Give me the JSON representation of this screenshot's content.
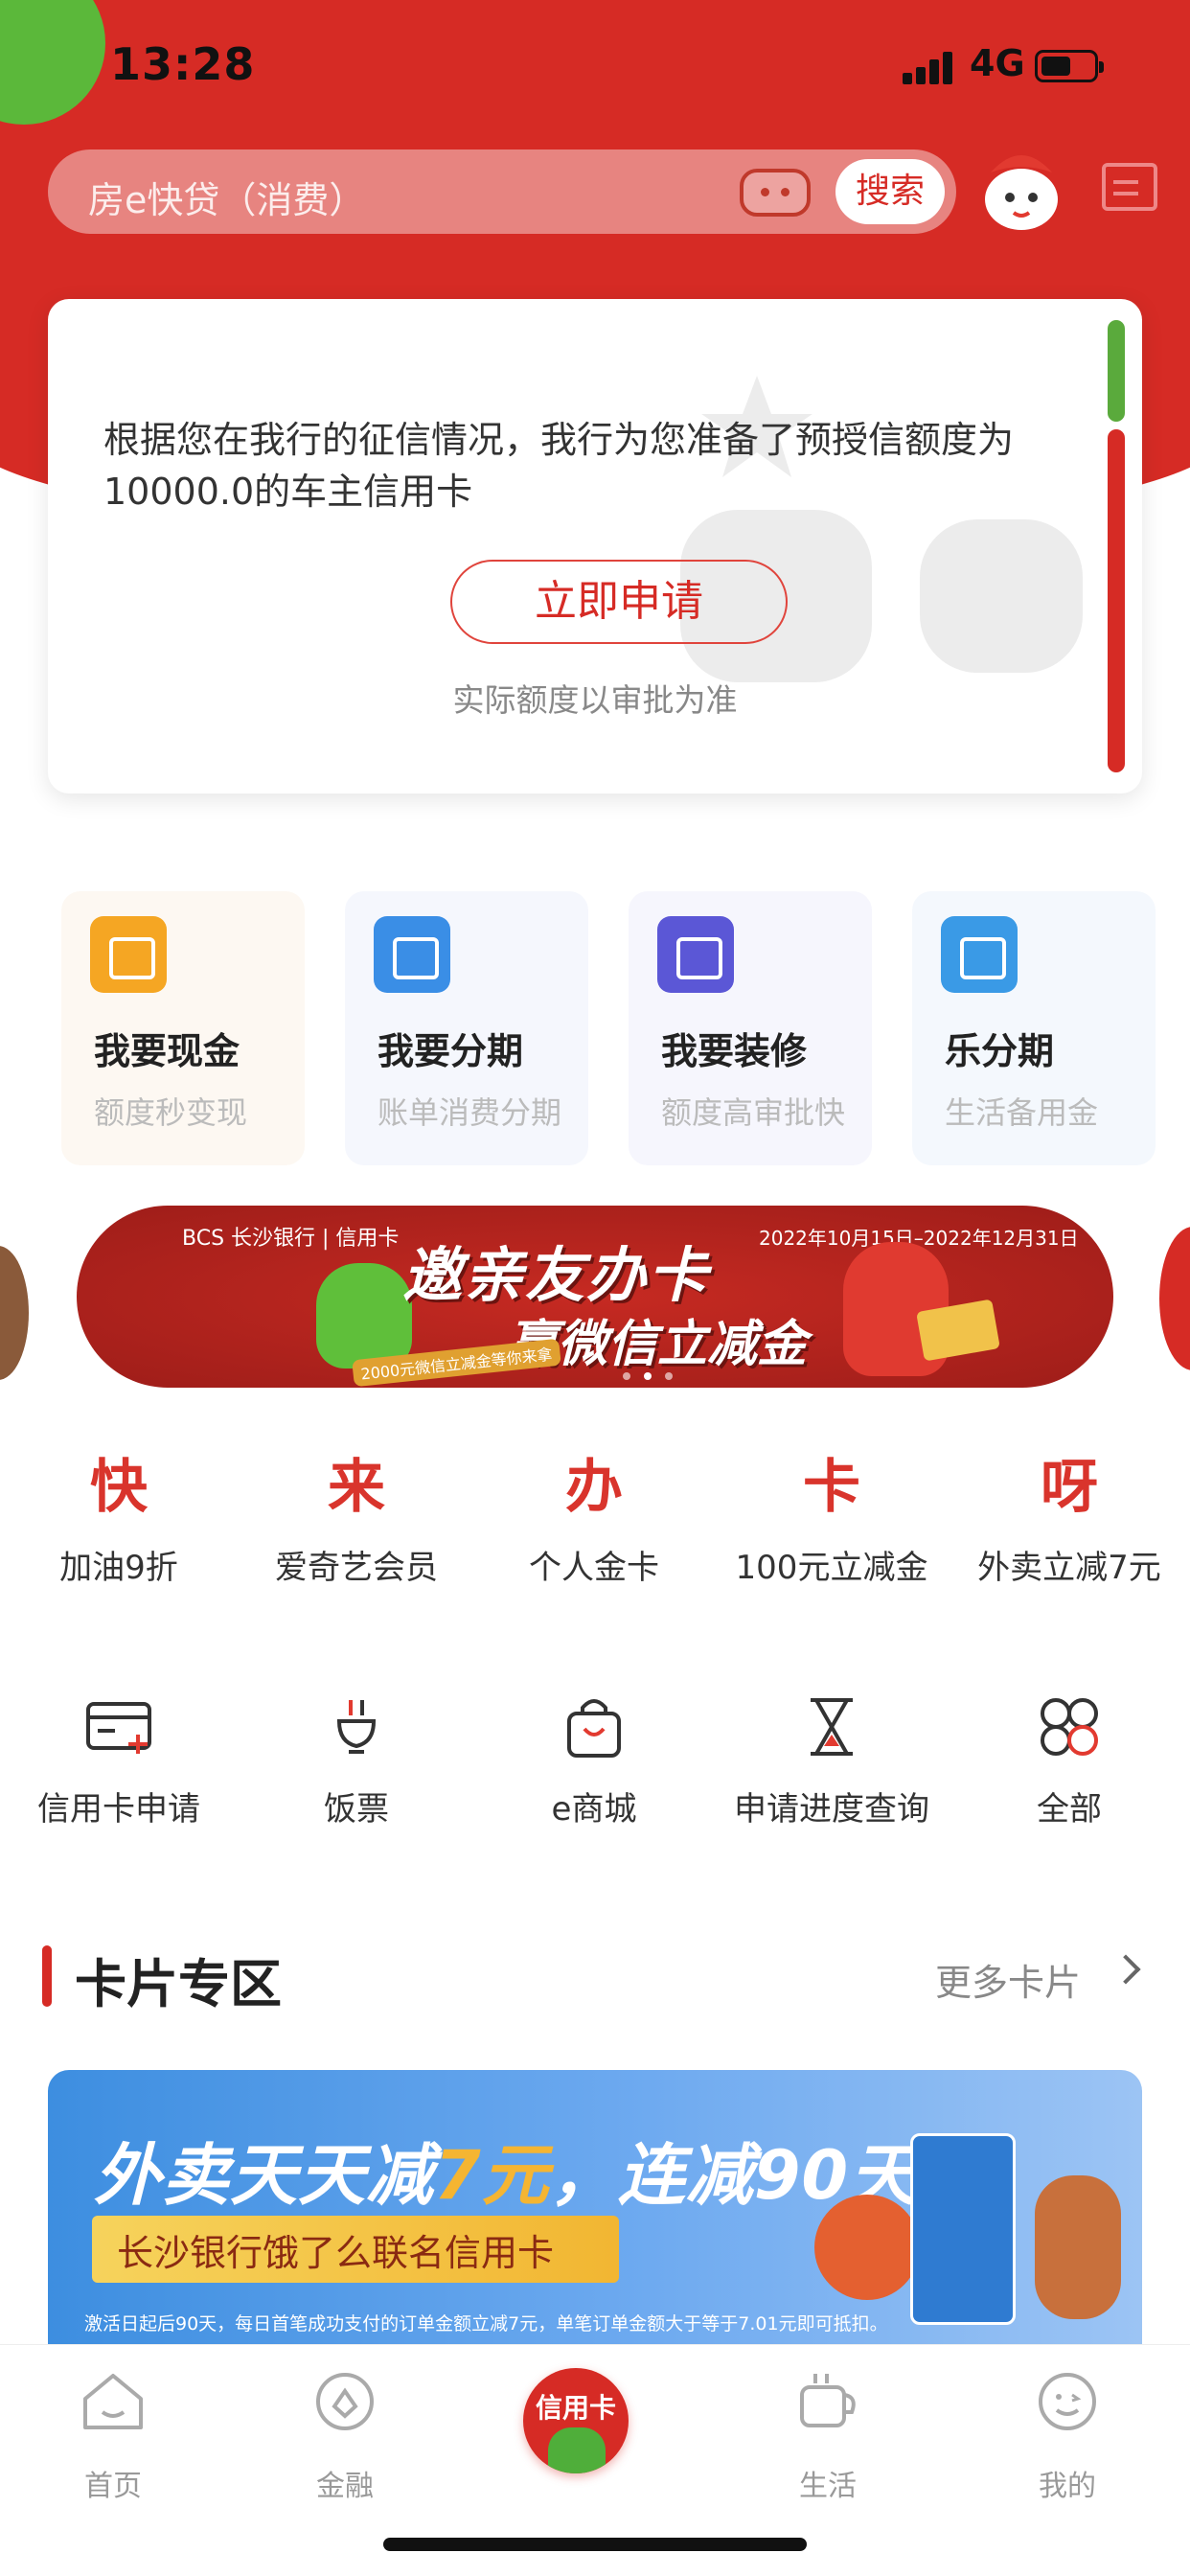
{
  "status_bar": {
    "time": "13:28",
    "network": "4G"
  },
  "search": {
    "placeholder": "房e快贷（消费）",
    "button": "搜索"
  },
  "notice": {
    "text": "根据您在我行的征信情况，我行为您准备了预授信额度为10000.0的车主信用卡",
    "apply_button": "立即申请",
    "hint": "实际额度以审批为准"
  },
  "features": [
    {
      "title": "我要现金",
      "subtitle": "额度秒变现",
      "icon": "wallet-icon",
      "color": "#f5a623"
    },
    {
      "title": "我要分期",
      "subtitle": "账单消费分期",
      "icon": "calendar-icon",
      "color": "#3a8ee6"
    },
    {
      "title": "我要装修",
      "subtitle": "额度高审批快",
      "icon": "paint-roller-icon",
      "color": "#5b57d6"
    },
    {
      "title": "乐分期",
      "subtitle": "生活备用金",
      "icon": "yuan-card-icon",
      "color": "#3a9ae6"
    }
  ],
  "banner": {
    "brand": "BCS 长沙银行 | 信用卡",
    "date_range": "2022年10月15日–2022年12月31日",
    "headline1": "邀亲友办卡",
    "headline2": "赢微信立减金",
    "tag": "2000元微信立减金等你来拿"
  },
  "promo_words": [
    {
      "char": "快",
      "label": "加油9折"
    },
    {
      "char": "来",
      "label": "爱奇艺会员"
    },
    {
      "char": "办",
      "label": "个人金卡"
    },
    {
      "char": "卡",
      "label": "100元立减金"
    },
    {
      "char": "呀",
      "label": "外卖立减7元"
    }
  ],
  "services": [
    {
      "label": "信用卡申请",
      "icon": "card-add-icon"
    },
    {
      "label": "饭票",
      "icon": "meal-ticket-icon"
    },
    {
      "label": "e商城",
      "icon": "shopping-bag-icon"
    },
    {
      "label": "申请进度查询",
      "icon": "hourglass-icon"
    },
    {
      "label": "全部",
      "icon": "grid-icon"
    }
  ],
  "card_zone": {
    "title": "卡片专区",
    "more": "更多卡片",
    "promo_headline_a": "外卖天天减",
    "promo_headline_b": "7元",
    "promo_headline_c": "，连减90天",
    "promo_sub": "长沙银行饿了么联名信用卡",
    "promo_fine": "激活日起后90天，每日首笔成功支付的订单金额立减7元，单笔订单金额大于等于7.01元即可抵扣。"
  },
  "tabs": [
    {
      "label": "首页",
      "icon": "home-icon"
    },
    {
      "label": "金融",
      "icon": "finance-icon"
    },
    {
      "label": "信用卡",
      "icon": "credit-card-icon"
    },
    {
      "label": "生活",
      "icon": "cup-icon"
    },
    {
      "label": "我的",
      "icon": "profile-icon"
    }
  ],
  "colors": {
    "brand_red": "#d62b25",
    "accent_green": "#5aaa3c"
  }
}
